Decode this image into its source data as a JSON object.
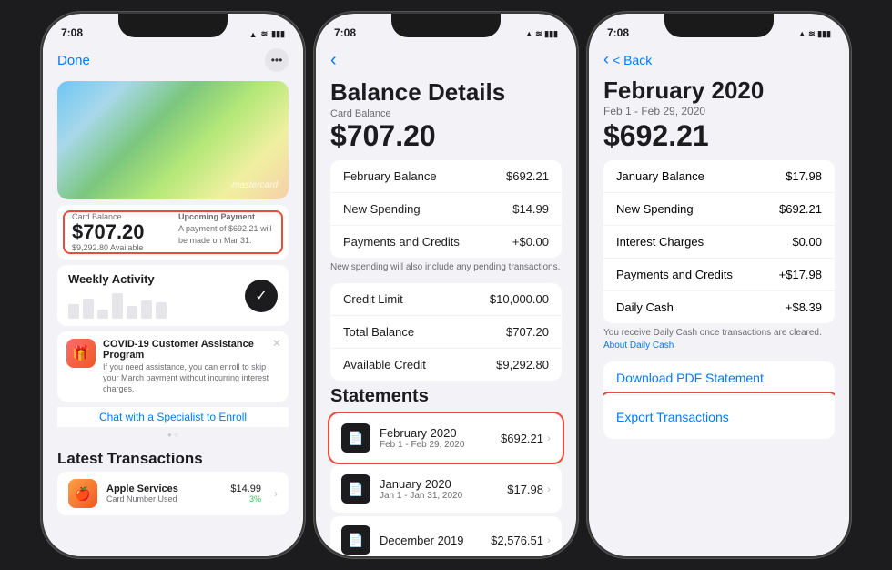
{
  "phone1": {
    "status": {
      "time": "7:08",
      "icons": "▲ ≋ ⬤"
    },
    "header": {
      "done": "Done",
      "more": "•••"
    },
    "card": {
      "logo": "",
      "brand": "mastercard"
    },
    "balance": {
      "label": "Card Balance",
      "amount": "$707.20",
      "available": "$9,292.80 Available"
    },
    "upcoming": {
      "label": "Upcoming Payment",
      "text": "A payment of $692.21 will be made on Mar 31."
    },
    "weekly": {
      "title": "Weekly Activity"
    },
    "covid": {
      "title": "COVID-19 Customer Assistance Program",
      "text": "If you need assistance, you can enroll to skip your March payment without incurring interest charges.",
      "chat": "Chat with a Specialist to Enroll"
    },
    "latest_title": "Latest Transactions",
    "transaction": {
      "name": "Apple Services",
      "sub": "Card Number Used",
      "amount": "$14.99",
      "cashback": "3%"
    }
  },
  "phone2": {
    "status": {
      "time": "7:08"
    },
    "title": "Balance Details",
    "card_balance_label": "Card Balance",
    "card_balance": "$707.20",
    "rows": [
      {
        "label": "February Balance",
        "value": "$692.21"
      },
      {
        "label": "New Spending",
        "value": "$14.99"
      },
      {
        "label": "Payments and Credits",
        "value": "+$0.00"
      }
    ],
    "note": "New spending will also include any pending transactions.",
    "rows2": [
      {
        "label": "Credit Limit",
        "value": "$10,000.00"
      },
      {
        "label": "Total Balance",
        "value": "$707.20"
      },
      {
        "label": "Available Credit",
        "value": "$9,292.80"
      }
    ],
    "statements_title": "Statements",
    "statements": [
      {
        "name": "February 2020",
        "date": "Feb 1 - Feb 29, 2020",
        "amount": "$692.21",
        "highlighted": true
      },
      {
        "name": "January 2020",
        "date": "Jan 1 - Jan 31, 2020",
        "amount": "$17.98",
        "highlighted": false
      },
      {
        "name": "December 2019",
        "date": "",
        "amount": "$2,576.51",
        "highlighted": false
      }
    ]
  },
  "phone3": {
    "status": {
      "time": "7:08"
    },
    "back": "< Back",
    "title": "February 2020",
    "date_range": "Feb 1 - Feb 29, 2020",
    "amount": "$692.21",
    "rows": [
      {
        "label": "January Balance",
        "value": "$17.98"
      },
      {
        "label": "New Spending",
        "value": "$692.21"
      },
      {
        "label": "Interest Charges",
        "value": "$0.00"
      },
      {
        "label": "Payments and Credits",
        "value": "+$17.98"
      },
      {
        "label": "Daily Cash",
        "value": "+$8.39"
      }
    ],
    "note": "You receive Daily Cash once transactions are cleared.",
    "note_link": "About Daily Cash",
    "download_pdf": "Download PDF Statement",
    "export": "Export Transactions"
  }
}
